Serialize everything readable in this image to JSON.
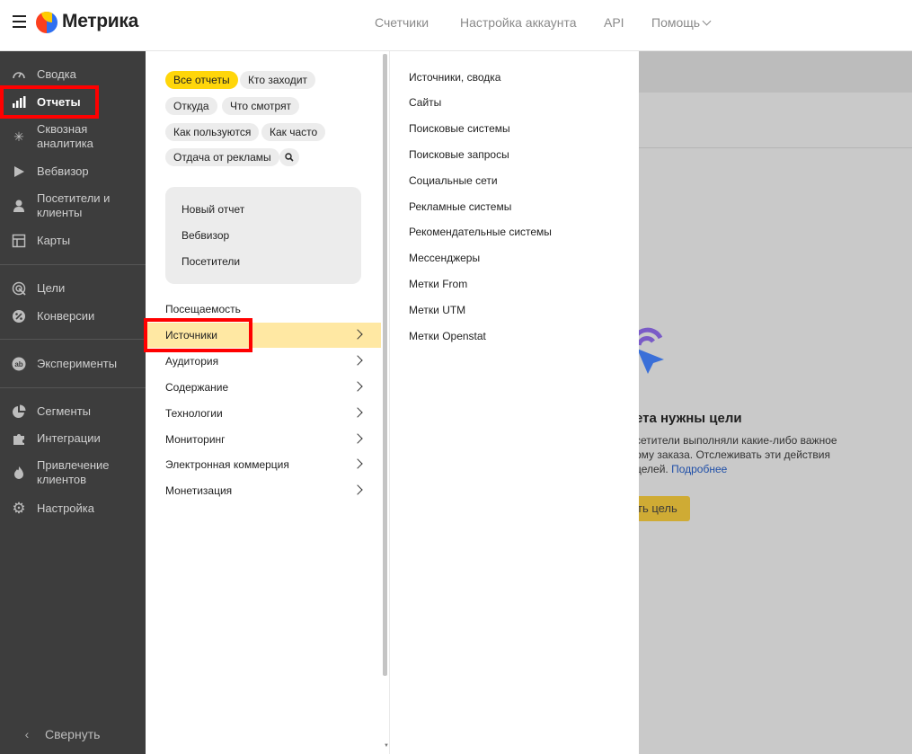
{
  "header": {
    "brand": "Метрика",
    "nav": [
      "Счетчики",
      "Настройка аккаунта",
      "API",
      "Помощь"
    ]
  },
  "sidebar": {
    "items": [
      {
        "label": "Сводка",
        "icon": "gauge-icon"
      },
      {
        "label": "Отчеты",
        "icon": "bar-chart-icon"
      },
      {
        "label": "Сквозная аналитика",
        "icon": "asterisk-icon"
      },
      {
        "label": "Вебвизор",
        "icon": "play-icon"
      },
      {
        "label": "Посетители и клиенты",
        "icon": "person-icon"
      },
      {
        "label": "Карты",
        "icon": "map-icon"
      },
      {
        "label": "Цели",
        "icon": "target-icon"
      },
      {
        "label": "Конверсии",
        "icon": "percent-icon"
      },
      {
        "label": "Эксперименты",
        "icon": "ab-icon"
      },
      {
        "label": "Сегменты",
        "icon": "pie-icon"
      },
      {
        "label": "Интеграции",
        "icon": "puzzle-icon"
      },
      {
        "label": "Привлечение клиентов",
        "icon": "flame-icon"
      },
      {
        "label": "Настройка",
        "icon": "gear-icon"
      }
    ],
    "collapse_label": "Свернуть"
  },
  "filters": {
    "chips": [
      "Все отчеты",
      "Кто заходит",
      "Откуда",
      "Что смотрят",
      "Как пользуются",
      "Как часто",
      "Отдача от рекламы"
    ]
  },
  "quick": {
    "items": [
      "Новый отчет",
      "Вебвизор",
      "Посетители"
    ]
  },
  "reports": {
    "items": [
      "Посещаемость",
      "Источники",
      "Аудитория",
      "Содержание",
      "Технологии",
      "Мониторинг",
      "Электронная коммерция",
      "Монетизация"
    ]
  },
  "sources": {
    "items": [
      "Источники, сводка",
      "Сайты",
      "Поисковые системы",
      "Поисковые запросы",
      "Социальные сети",
      "Рекламные системы",
      "Рекомендательные системы",
      "Мессенджеры",
      "Метки From",
      "Метки UTM",
      "Метки Openstat"
    ]
  },
  "main": {
    "goal_title": "ета нужны цели",
    "goal_line1": "сетители выполняли какие-либо важное",
    "goal_line2": "рму заказа. Отслеживать эти действия",
    "goal_line3": "целей.",
    "goal_link": "Подробнее",
    "goal_button": "ть цель"
  },
  "colors": {
    "sidebar_bg": "#3d3d3d",
    "accent_yellow": "#ffd60a",
    "active_row": "#ffe8a3",
    "highlight_red": "#ff0000"
  }
}
